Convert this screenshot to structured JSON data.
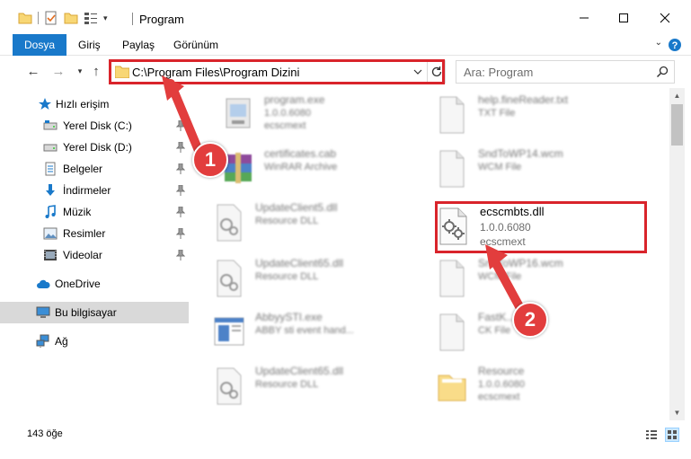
{
  "window": {
    "title": "Program",
    "controls": {
      "minimize": "minimize-icon",
      "maximize": "maximize-icon",
      "close": "close-icon"
    }
  },
  "ribbon": {
    "tabs": [
      {
        "label": "Dosya",
        "active": true
      },
      {
        "label": "Giriş"
      },
      {
        "label": "Paylaş"
      },
      {
        "label": "Görünüm"
      }
    ]
  },
  "address": {
    "path": "C:\\Program Files\\Program Dizini"
  },
  "search": {
    "placeholder": "Ara: Program"
  },
  "sidebar": {
    "items": [
      {
        "label": "Hızlı erişim",
        "icon": "star-icon"
      },
      {
        "label": "Yerel Disk (C:)",
        "icon": "drive-icon",
        "pinned": true
      },
      {
        "label": "Yerel Disk (D:)",
        "icon": "drive-icon",
        "pinned": true
      },
      {
        "label": "Belgeler",
        "icon": "documents-icon",
        "pinned": true
      },
      {
        "label": "İndirmeler",
        "icon": "download-icon",
        "pinned": true
      },
      {
        "label": "Müzik",
        "icon": "music-icon",
        "pinned": true
      },
      {
        "label": "Resimler",
        "icon": "pictures-icon",
        "pinned": true
      },
      {
        "label": "Videolar",
        "icon": "video-icon",
        "pinned": true
      },
      {
        "label": "OneDrive",
        "icon": "cloud-icon"
      },
      {
        "label": "Bu bilgisayar",
        "icon": "computer-icon",
        "selected": true
      },
      {
        "label": "Ağ",
        "icon": "network-icon"
      }
    ]
  },
  "files": [
    {
      "name": "program.exe",
      "line1": "1.0.0.6080",
      "line2": "ecscmext",
      "icon": "exe-icon",
      "blurred": true
    },
    {
      "name": "help.fineReader.txt",
      "line1": "TXT File",
      "line2": "",
      "icon": "text-file-icon",
      "blurred": true
    },
    {
      "name": "certificates.cab",
      "line1": "WinRAR Archive",
      "line2": "",
      "icon": "archive-icon",
      "blurred": true
    },
    {
      "name": "SndToWP14.wcm",
      "line1": "WCM File",
      "line2": "",
      "icon": "generic-file-icon",
      "blurred": true
    },
    {
      "name": "UpdateClient5.dll",
      "line1": "Resource DLL",
      "line2": "",
      "icon": "dll-icon",
      "blurred": true
    },
    {
      "name": "ecscmbts.dll",
      "line1": "1.0.0.6080",
      "line2": "ecscmext",
      "icon": "dll-icon",
      "blurred": false
    },
    {
      "name": "UpdateClient65.dll",
      "line1": "Resource DLL",
      "line2": "",
      "icon": "dll-icon",
      "blurred": true
    },
    {
      "name": "SndToWP16.wcm",
      "line1": "WCM File",
      "line2": "",
      "icon": "generic-file-icon",
      "blurred": true
    },
    {
      "name": "AbbyySTI.exe",
      "line1": "ABBY sti event hand...",
      "line2": "",
      "icon": "app-icon",
      "blurred": true
    },
    {
      "name": "FastK...",
      "line1": "CK File",
      "line2": "",
      "icon": "generic-file-icon",
      "blurred": true
    },
    {
      "name": "UpdateClient65.dll",
      "line1": "Resource DLL",
      "line2": "",
      "icon": "dll-icon",
      "blurred": true
    },
    {
      "name": "Resource",
      "line1": "1.0.0.6080",
      "line2": "ecscmext",
      "icon": "folder-icon",
      "blurred": true
    }
  ],
  "status": {
    "count": "143 öğe"
  },
  "annotations": [
    {
      "label": "1",
      "color": "#e23d3d"
    },
    {
      "label": "2",
      "color": "#e23d3d"
    }
  ]
}
